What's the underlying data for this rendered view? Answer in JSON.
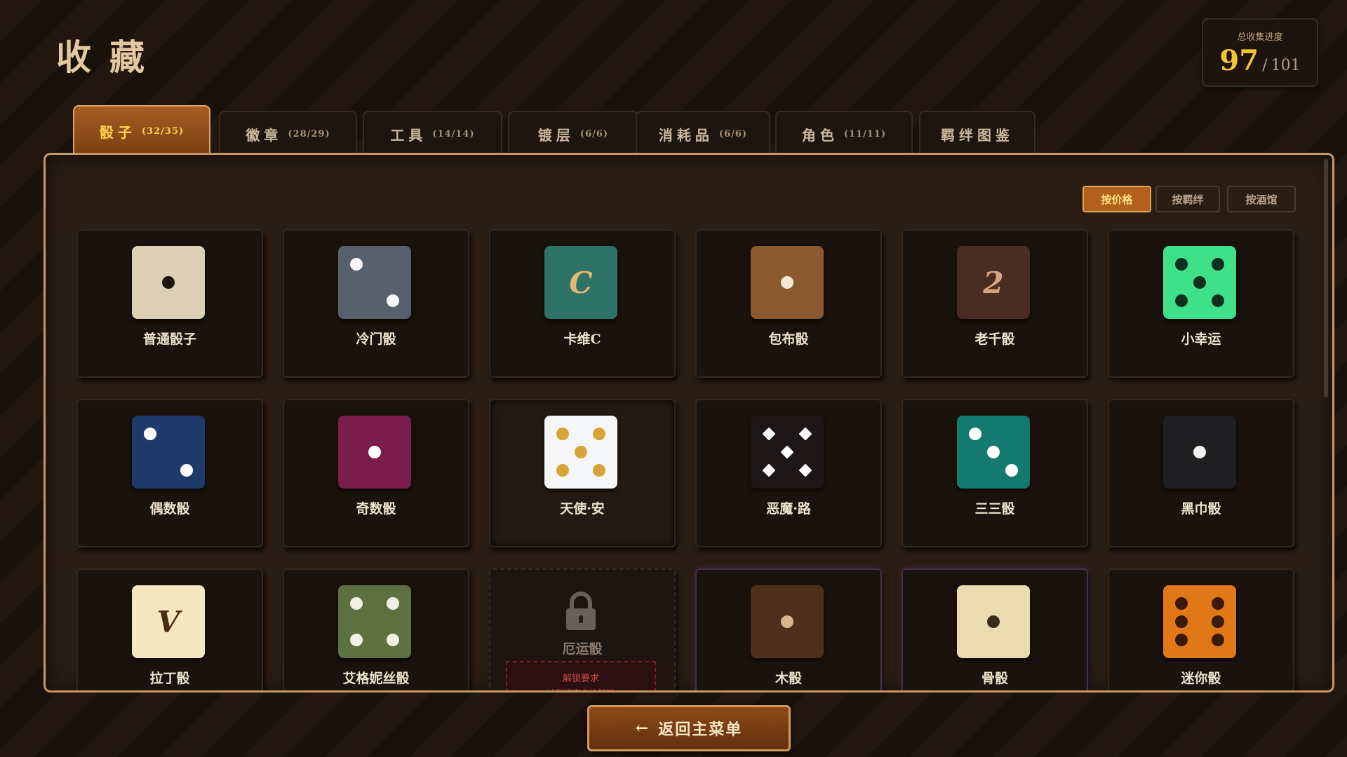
{
  "header": {
    "title": "收藏"
  },
  "progress": {
    "label": "总收集进度",
    "current": "97",
    "separator": "/",
    "total": "101"
  },
  "tabs": [
    {
      "label": "骰子",
      "count": "(32/35)",
      "active": true
    },
    {
      "label": "徽章",
      "count": "(28/29)"
    },
    {
      "label": "工具",
      "count": "(14/14)"
    },
    {
      "label": "镀层",
      "count": "(6/6)"
    },
    {
      "label": "消耗品",
      "count": "(6/6)"
    },
    {
      "label": "角色",
      "count": "(11/11)"
    },
    {
      "label": "羁绊图鉴",
      "count": ""
    }
  ],
  "sort_buttons": [
    {
      "label": "按价格",
      "active": true
    },
    {
      "label": "按羁绊"
    },
    {
      "label": "按酒馆"
    }
  ],
  "colors": {
    "accent": "#f3c433",
    "tab_active": "#a75d22",
    "panel_border": "#c49868",
    "locked_red": "#d44848"
  },
  "dice": [
    {
      "name": "普通骰子",
      "face": "#dccfb6",
      "pips": 1,
      "pip_color": "#1e140e"
    },
    {
      "name": "冷门骰",
      "face": "#58606e",
      "pips": 2,
      "pip_color": "#f5f5f5"
    },
    {
      "name": "卡维C",
      "face": "#2f7268",
      "glyph": "C",
      "glyph_color": "#e5b873"
    },
    {
      "name": "包布骰",
      "face": "#8a5a2e",
      "pips": 1,
      "pip_color": "#f3ead6"
    },
    {
      "name": "老千骰",
      "face": "#4a2c22",
      "glyph": "2",
      "glyph_color": "#d7a482"
    },
    {
      "name": "小幸运",
      "face": "#3fe08a",
      "pips": 5,
      "pip_color": "#10301e"
    },
    {
      "name": "偶数骰",
      "face": "#1d3a6a",
      "pips": 2,
      "pip_color": "#ffffff"
    },
    {
      "name": "奇数骰",
      "face": "#7a1c4c",
      "pips": 1,
      "pip_color": "#ffffff"
    },
    {
      "name": "天使·安",
      "face": "#f4f6f8",
      "pips": 5,
      "pip_color": "#d8a438",
      "pressed": true
    },
    {
      "name": "恶魔·路",
      "face": "#1c1616",
      "pips": 5,
      "pip_color": "#ffffff",
      "pip_shape": "diamond"
    },
    {
      "name": "三三骰",
      "face": "#137a70",
      "pips": 3,
      "pip_color": "#ffffff"
    },
    {
      "name": "黑巾骰",
      "face": "#1f1f22",
      "pips": 1,
      "pip_color": "#f0f0f0"
    },
    {
      "name": "拉丁骰",
      "face": "#f5e7c0",
      "glyph": "V",
      "glyph_color": "#4a2a14"
    },
    {
      "name": "艾格妮丝骰",
      "face": "#5e7040",
      "pips": 4,
      "pip_color": "#f2f0e4"
    },
    {
      "name": "厄运骰",
      "locked": true,
      "req_title": "解锁要求",
      "req_text": "达到特定条件解锁"
    },
    {
      "name": "木骰",
      "face": "#4e2f1c",
      "pips": 1,
      "pip_color": "#d9b58a",
      "glow": true
    },
    {
      "name": "骨骰",
      "face": "#eadbb0",
      "pips": 1,
      "pip_color": "#3a2b20",
      "glow": true
    },
    {
      "name": "迷你骰",
      "face": "#e07818",
      "pips": 6,
      "pip_color": "#3a1a0a"
    }
  ],
  "footer": {
    "back_arrow": "←",
    "back_label": "返回主菜单"
  }
}
